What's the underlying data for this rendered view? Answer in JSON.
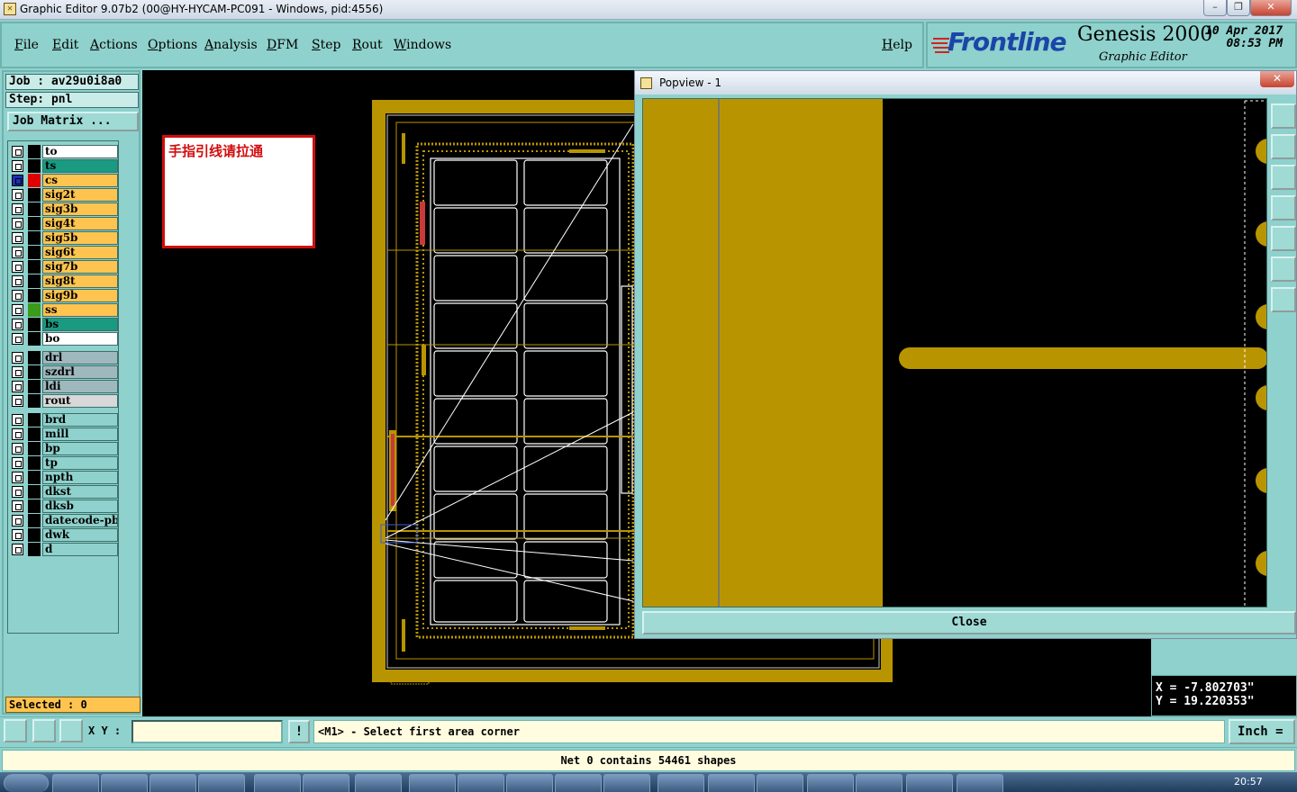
{
  "window": {
    "title": "Graphic Editor 9.07b2 (00@HY-HYCAM-PC091 - Windows, pid:4556)",
    "minimize": "–",
    "maximize": "❐",
    "close": "✕"
  },
  "menu": [
    "File",
    "Edit",
    "Actions",
    "Options",
    "Analysis",
    "DFM",
    "Step",
    "Rout",
    "Windows"
  ],
  "help": "Help",
  "brand": {
    "logo": "Frontline",
    "product": "Genesis 2000",
    "subtitle": "Graphic Editor",
    "date": "10 Apr 2017",
    "time": "08:53 PM"
  },
  "job": {
    "job_line": "Job : av29u0i8a0",
    "step_line": "Step: pnl",
    "matrix_button": "Job Matrix ..."
  },
  "layers": [
    {
      "name": "to",
      "color": "#ffffff",
      "swatch": "#000000"
    },
    {
      "name": "ts",
      "color": "#1a9a80",
      "swatch": "#000000"
    },
    {
      "name": "cs",
      "color": "#ffc44f",
      "swatch": "#e00000",
      "active": true
    },
    {
      "name": "sig2t",
      "color": "#ffc44f",
      "swatch": "#000000"
    },
    {
      "name": "sig3b",
      "color": "#ffc44f",
      "swatch": "#000000"
    },
    {
      "name": "sig4t",
      "color": "#ffc44f",
      "swatch": "#000000"
    },
    {
      "name": "sig5b",
      "color": "#ffc44f",
      "swatch": "#000000"
    },
    {
      "name": "sig6t",
      "color": "#ffc44f",
      "swatch": "#000000"
    },
    {
      "name": "sig7b",
      "color": "#ffc44f",
      "swatch": "#000000"
    },
    {
      "name": "sig8t",
      "color": "#ffc44f",
      "swatch": "#000000"
    },
    {
      "name": "sig9b",
      "color": "#ffc44f",
      "swatch": "#000000"
    },
    {
      "name": "ss",
      "color": "#ffc44f",
      "swatch": "#3a9c1a"
    },
    {
      "name": "bs",
      "color": "#1a9a80",
      "swatch": "#000000"
    },
    {
      "name": "bo",
      "color": "#ffffff",
      "swatch": "#000000"
    },
    {
      "name": "drl",
      "color": "#9fb8be",
      "swatch": "#000000",
      "gap": true
    },
    {
      "name": "szdrl",
      "color": "#9fb8be",
      "swatch": "#000000"
    },
    {
      "name": "ldi",
      "color": "#9fb8be",
      "swatch": "#000000"
    },
    {
      "name": "rout",
      "color": "#d8d8d8",
      "swatch": "#000000"
    },
    {
      "name": "brd",
      "color": "#8fd1cc",
      "swatch": "#000000",
      "gap": true
    },
    {
      "name": "mill",
      "color": "#8fd1cc",
      "swatch": "#000000"
    },
    {
      "name": "bp",
      "color": "#8fd1cc",
      "swatch": "#000000"
    },
    {
      "name": "tp",
      "color": "#8fd1cc",
      "swatch": "#000000"
    },
    {
      "name": "npth",
      "color": "#8fd1cc",
      "swatch": "#000000"
    },
    {
      "name": "dkst",
      "color": "#8fd1cc",
      "swatch": "#000000"
    },
    {
      "name": "dksb",
      "color": "#8fd1cc",
      "swatch": "#000000"
    },
    {
      "name": "datecode-pbo",
      "color": "#8fd1cc",
      "swatch": "#000000"
    },
    {
      "name": "dwk",
      "color": "#8fd1cc",
      "swatch": "#000000"
    },
    {
      "name": "d",
      "color": "#8fd1cc",
      "swatch": "#000000"
    }
  ],
  "selected": "Selected : 0",
  "note": "手指引线请拉通",
  "popview": {
    "title": "Popview - 1",
    "close_x": "✕",
    "close_button": "Close",
    "tools": [
      "zoom-window-icon",
      "pan-up-icon",
      "pan-down-icon",
      "pan-left-icon",
      "pan-right-icon",
      "zoom-home-icon",
      "zoom-fit-icon"
    ]
  },
  "coords": {
    "x": "X = -7.802703\"",
    "y": "Y = 19.220353\""
  },
  "cmd": {
    "xy_label": "X Y :",
    "xy_value": "",
    "bang": "!",
    "prompt": "<M1> - Select first area corner",
    "unit": "Inch ="
  },
  "status": "Net 0 contains 54461 shapes",
  "taskbar": {
    "clock": "20:57"
  },
  "colors": {
    "panel": "#8fd1cc",
    "copper": "#b89500",
    "canvas": "#000000",
    "note_border": "#d10d0d"
  }
}
